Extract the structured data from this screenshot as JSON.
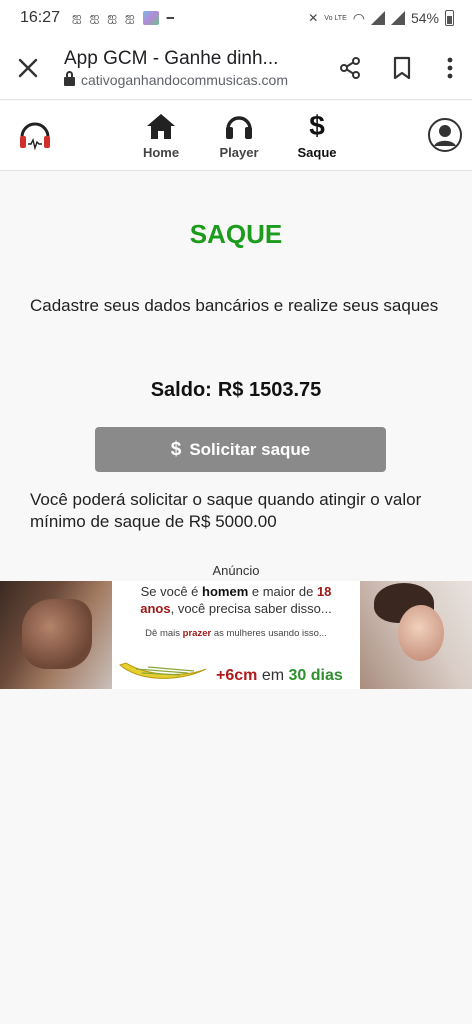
{
  "status_bar": {
    "time": "16:27",
    "battery": "54%",
    "network_label": "Vo LTE"
  },
  "browser": {
    "title": "App GCM - Ganhe dinh...",
    "url": "cativoganhandocommusicas.com"
  },
  "nav": {
    "items": [
      {
        "label": "Home",
        "icon": "home-icon"
      },
      {
        "label": "Player",
        "icon": "headphones-icon"
      },
      {
        "label": "Saque",
        "icon": "dollar-icon",
        "active": true
      }
    ]
  },
  "main": {
    "title": "SAQUE",
    "intro": "Cadastre seus dados bancários e realize seus saques",
    "balance_label": "Saldo:",
    "balance_value": "R$ 1503.75",
    "withdraw_button": "Solicitar saque",
    "min_note": "Você poderá solicitar o saque quando atingir o valor mínimo de saque de R$ 5000.00",
    "ad_label": "Anúncio"
  },
  "ad": {
    "line1_a": "Se você é",
    "line1_b": "homem",
    "line1_c": "e maior de",
    "line1_d": "18",
    "line2_a": "anos",
    "line2_b": ", você precisa saber disso...",
    "line3_a": "Dê mais",
    "line3_b": "prazer",
    "line3_c": "as mulheres usando isso...",
    "line4_a": "+6cm",
    "line4_b": "em",
    "line4_c": "30 dias"
  },
  "colors": {
    "title_green": "#1d9b1d",
    "button_gray": "#8a8a8a",
    "logo_red": "#d32f2f"
  }
}
